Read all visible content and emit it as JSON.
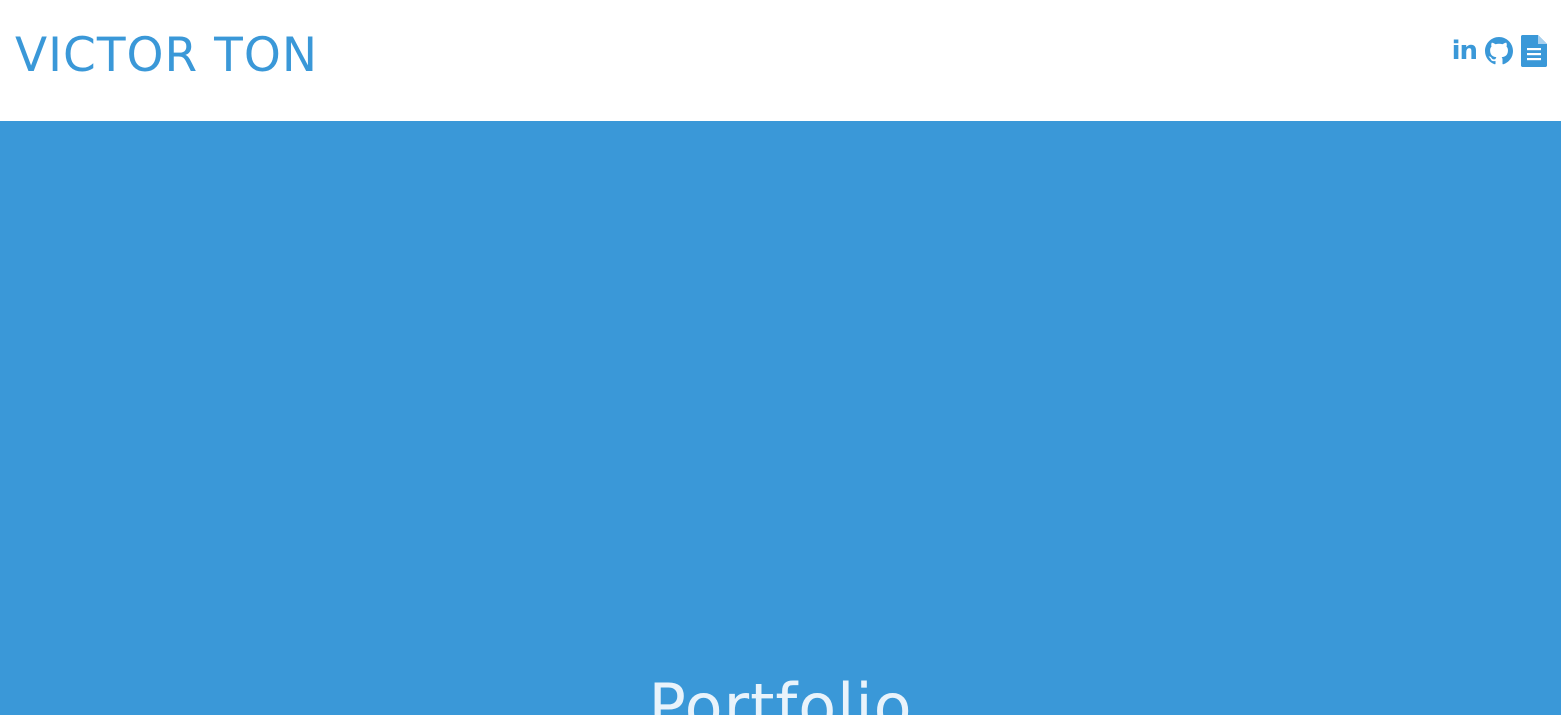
{
  "header": {
    "brand": "VICTOR TON",
    "social": {
      "linkedin_label": "in",
      "linkedin_icon": "linkedin-icon",
      "github_icon": "github-icon",
      "resume_icon": "document-icon"
    }
  },
  "hero": {
    "title": "Portfolio"
  },
  "colors": {
    "accent": "#3a98d8",
    "hero_text": "#e9f3fb",
    "background": "#ffffff"
  }
}
